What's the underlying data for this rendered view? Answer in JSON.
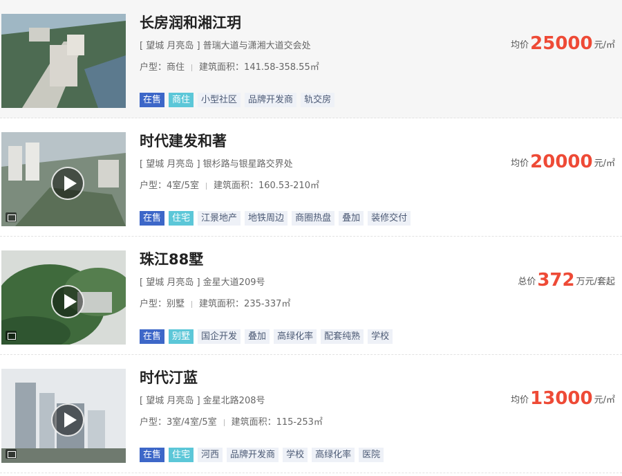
{
  "listings": [
    {
      "title": "长房润和湘江玥",
      "address": "[ 望城 月亮岛 ] 普瑞大道与潇湘大道交会处",
      "specs_type_label": "户型：",
      "specs_type": "商住",
      "specs_area_label": "建筑面积：",
      "specs_area": "141.58-358.55㎡",
      "price_label": "均价",
      "price_value": "25000",
      "price_unit": "元/㎡",
      "status": "在售",
      "prop_type": "商住",
      "tags": [
        "小型社区",
        "品牌开发商",
        "轨交房"
      ],
      "has_video": false
    },
    {
      "title": "时代建发和著",
      "address": "[ 望城 月亮岛 ] 银杉路与银星路交界处",
      "specs_type_label": "户型：",
      "specs_type": "4室/5室",
      "specs_area_label": "建筑面积：",
      "specs_area": "160.53-210㎡",
      "price_label": "均价",
      "price_value": "20000",
      "price_unit": "元/㎡",
      "status": "在售",
      "prop_type": "住宅",
      "tags": [
        "江景地产",
        "地铁周边",
        "商圈热盘",
        "叠加",
        "装修交付"
      ],
      "has_video": true
    },
    {
      "title": "珠江88墅",
      "address": "[ 望城 月亮岛 ] 金星大道209号",
      "specs_type_label": "户型：",
      "specs_type": "别墅",
      "specs_area_label": "建筑面积：",
      "specs_area": "235-337㎡",
      "price_label": "总价",
      "price_value": "372",
      "price_unit": "万元/套起",
      "status": "在售",
      "prop_type": "别墅",
      "tags": [
        "国企开发",
        "叠加",
        "高绿化率",
        "配套纯熟",
        "学校"
      ],
      "has_video": true
    },
    {
      "title": "时代汀蓝",
      "address": "[ 望城 月亮岛 ] 金星北路208号",
      "specs_type_label": "户型：",
      "specs_type": "3室/4室/5室",
      "specs_area_label": "建筑面积：",
      "specs_area": "115-253㎡",
      "price_label": "均价",
      "price_value": "13000",
      "price_unit": "元/㎡",
      "status": "在售",
      "prop_type": "住宅",
      "tags": [
        "河西",
        "品牌开发商",
        "学校",
        "高绿化率",
        "医院"
      ],
      "has_video": true
    }
  ]
}
